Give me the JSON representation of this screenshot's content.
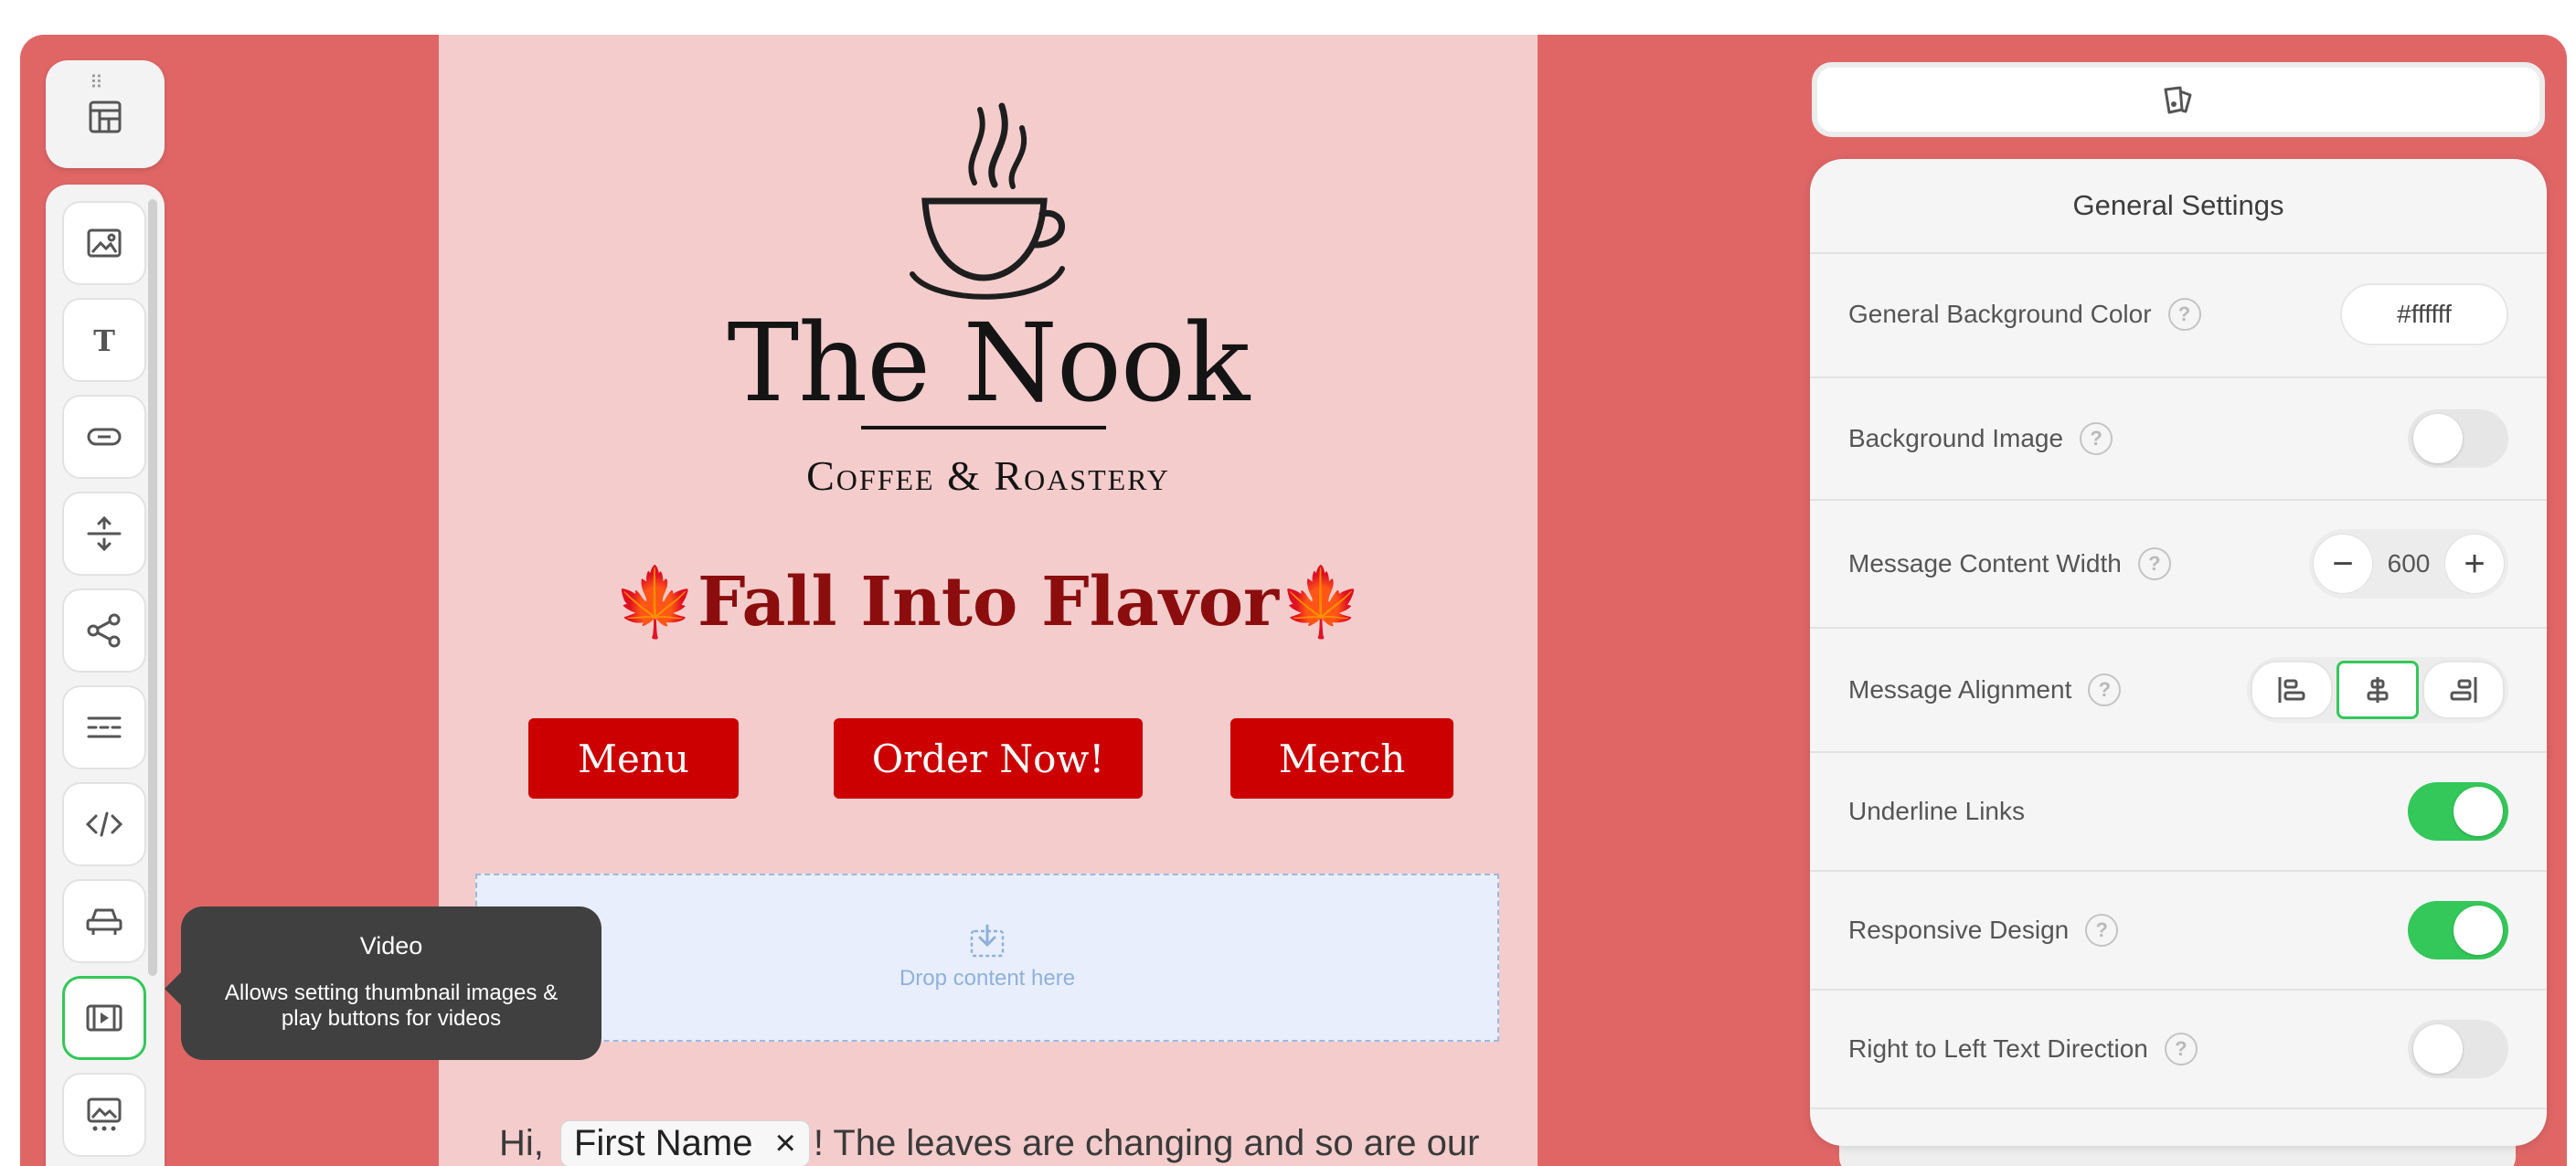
{
  "canvas": {
    "logo_title": "The Nook",
    "logo_subtitle": "Coffee & Roastery",
    "headline": "🍁Fall Into Flavor🍁",
    "buttons": [
      "Menu",
      "Order Now!",
      "Merch"
    ],
    "dropzone_label": "Drop content here",
    "body_prefix": "Hi,",
    "merge_tag": "First Name",
    "merge_tag_remove": "×",
    "body_suffix": "! The leaves are changing and so are our"
  },
  "toolbar": {
    "grip": "⠿",
    "tools": [
      {
        "name": "image",
        "icon": "image-icon"
      },
      {
        "name": "text",
        "icon": "text-icon"
      },
      {
        "name": "button",
        "icon": "button-icon"
      },
      {
        "name": "spacer",
        "icon": "spacer-icon"
      },
      {
        "name": "social",
        "icon": "share-icon"
      },
      {
        "name": "divider",
        "icon": "divider-icon"
      },
      {
        "name": "html",
        "icon": "code-icon"
      },
      {
        "name": "header",
        "icon": "menu-bar-icon"
      },
      {
        "name": "video",
        "icon": "video-icon",
        "active": true
      },
      {
        "name": "carousel",
        "icon": "image-carousel-icon"
      }
    ]
  },
  "tooltip": {
    "title": "Video",
    "description": "Allows setting thumbnail images & play buttons for videos"
  },
  "settings": {
    "title": "General Settings",
    "rows": {
      "bg_color": {
        "label": "General Background Color",
        "value": "#ffffff"
      },
      "bg_image": {
        "label": "Background Image",
        "enabled": false
      },
      "content_width": {
        "label": "Message Content Width",
        "value": "600",
        "minus": "−",
        "plus": "+"
      },
      "alignment": {
        "label": "Message Alignment",
        "selected": "center"
      },
      "underline_links": {
        "label": "Underline Links",
        "enabled": true
      },
      "responsive": {
        "label": "Responsive Design",
        "enabled": true
      },
      "rtl": {
        "label": "Right to Left Text Direction",
        "enabled": false
      }
    },
    "help_glyph": "?"
  },
  "colors": {
    "app_bg": "#e06666",
    "canvas_bg": "#f4cccc",
    "button_red": "#cc0000",
    "headline": "#8b0d0d",
    "accent_green": "#34c759"
  }
}
